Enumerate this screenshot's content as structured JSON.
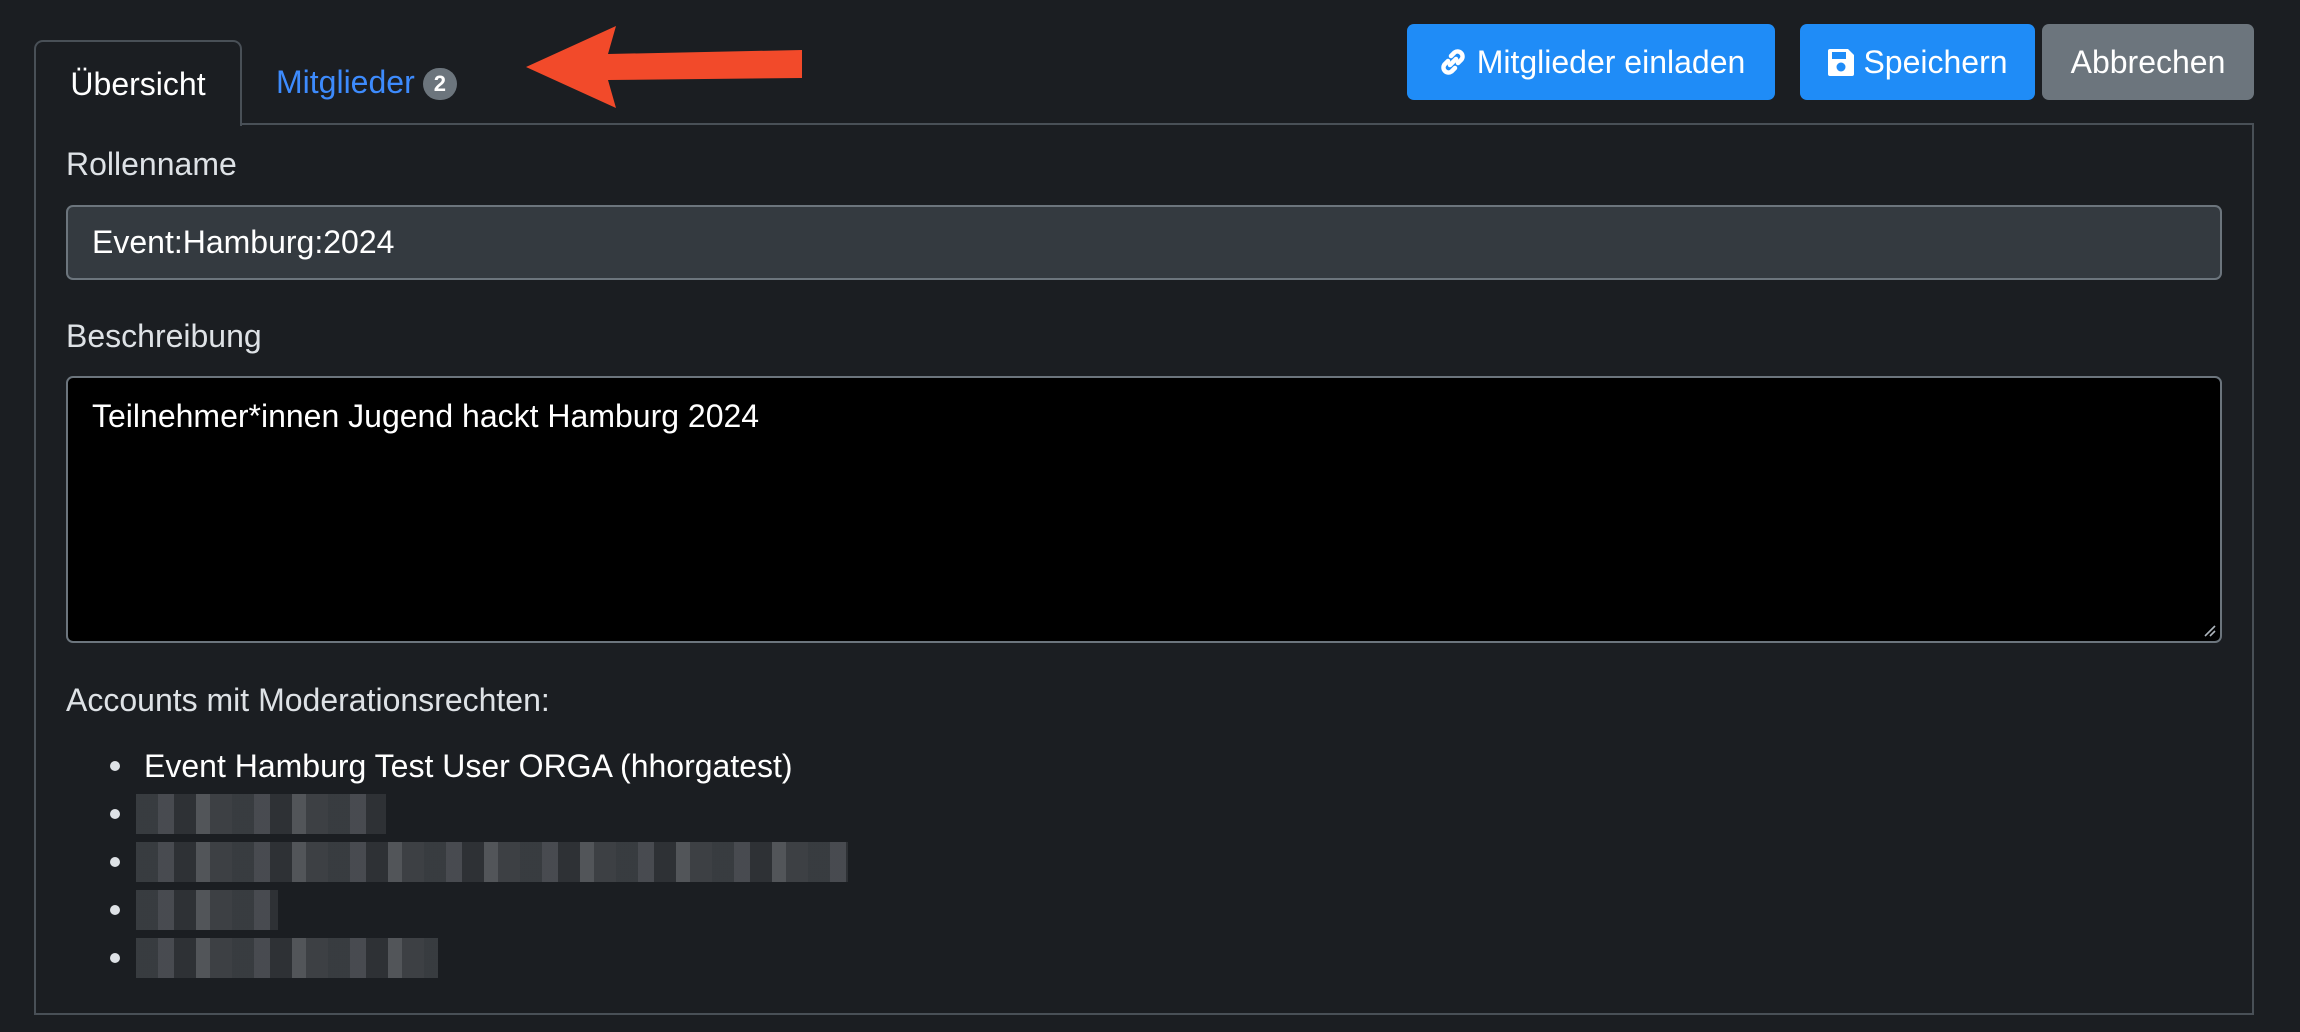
{
  "tabs": {
    "overview_label": "Übersicht",
    "members_label": "Mitglieder",
    "members_count": "2"
  },
  "toolbar": {
    "invite_label": "Mitglieder einladen",
    "save_label": "Speichern",
    "cancel_label": "Abbrechen"
  },
  "form": {
    "role_name_label": "Rollenname",
    "role_name_value": "Event:Hamburg:2024",
    "description_label": "Beschreibung",
    "description_value": "Teilnehmer*innen Jugend hackt Hamburg 2024",
    "moderators_label": "Accounts mit Moderationsrechten:",
    "moderators": [
      "Event Hamburg Test User ORGA (hhorgatest)"
    ]
  },
  "colors": {
    "background": "#1b1e22",
    "primary": "#1f8cf7",
    "secondary": "#6c757d",
    "link": "#3d8bfd",
    "arrow": "#f24a2a"
  },
  "icons": {
    "invite": "link-icon",
    "save": "floppy-disk-icon",
    "arrow": "red-arrow-annotation"
  }
}
